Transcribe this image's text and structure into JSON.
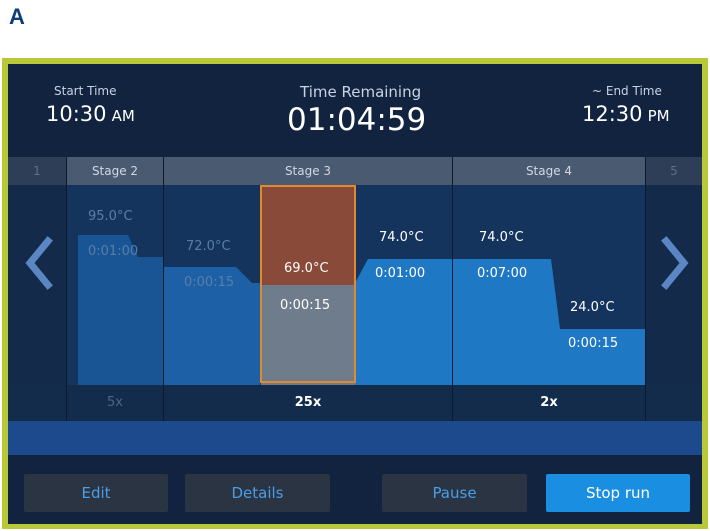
{
  "panel_label": "A",
  "header": {
    "start_label": "Start Time",
    "start_time": "10:30",
    "start_unit": "AM",
    "remaining_label": "Time Remaining",
    "remaining_value": "01:04:59",
    "end_label": "~ End Time",
    "end_time": "12:30",
    "end_unit": "PM"
  },
  "stages": {
    "left_edge": "1",
    "s2": "Stage 2",
    "s3": "Stage 3",
    "s4": "Stage 4",
    "right_edge": "5"
  },
  "steps": [
    {
      "temp": "95.0°C",
      "time": "0:01:00"
    },
    {
      "temp": "72.0°C",
      "time": "0:00:15"
    },
    {
      "temp": "69.0°C",
      "time": "0:00:15"
    },
    {
      "temp": "74.0°C",
      "time": "0:01:00"
    },
    {
      "temp": "74.0°C",
      "time": "0:07:00"
    },
    {
      "temp": "24.0°C",
      "time": "0:00:15"
    }
  ],
  "cycles": {
    "s2": "5x",
    "s3": "25x",
    "s4": "2x"
  },
  "buttons": {
    "edit": "Edit",
    "details": "Details",
    "pause": "Pause",
    "stop": "Stop run"
  },
  "colors": {
    "frame": "#b8c838",
    "accent": "#1a8ee0",
    "selected_border": "#e08a30"
  },
  "icons": {
    "prev": "chevron-left-icon",
    "next": "chevron-right-icon"
  }
}
